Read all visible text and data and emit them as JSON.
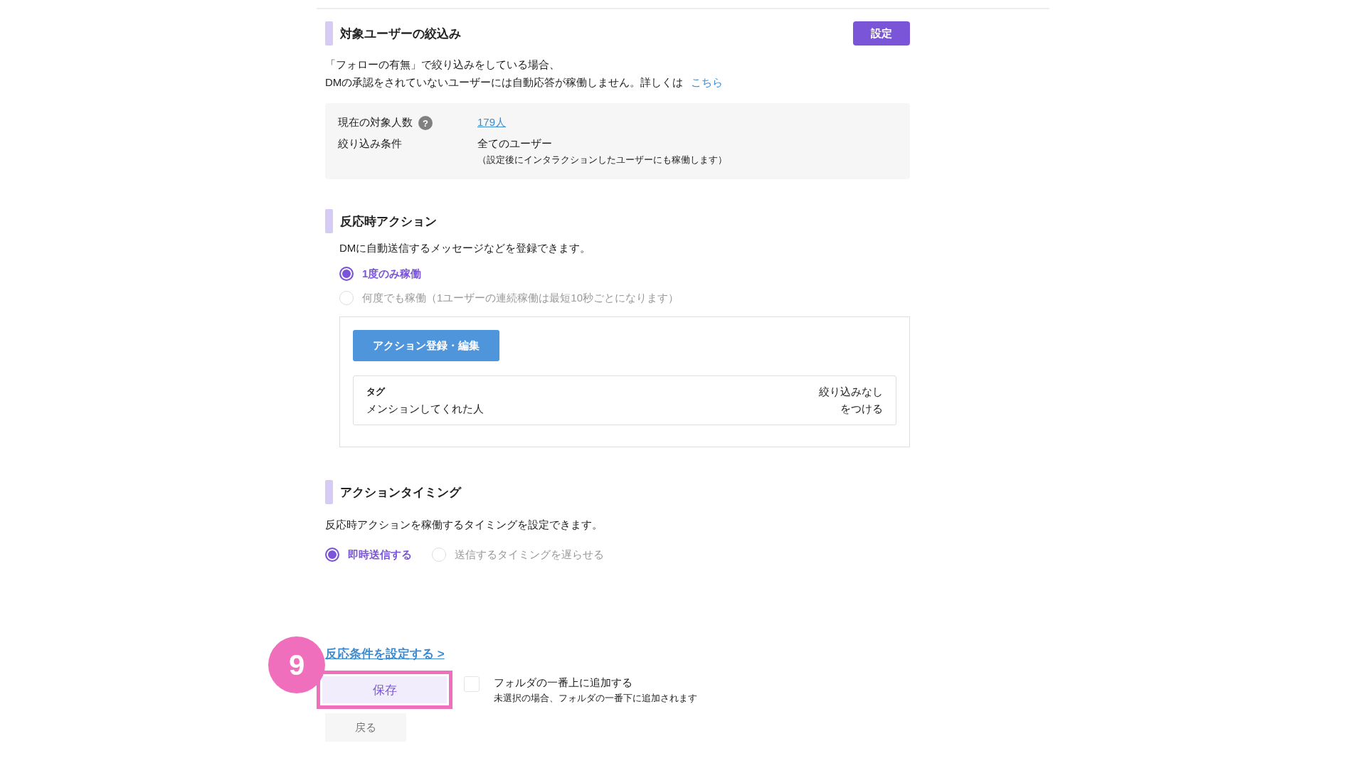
{
  "filter_section": {
    "title": "対象ユーザーの絞込み",
    "button": "設定",
    "note_lines": [
      "「フォローの有無」で絞り込みをしている場合、",
      "DMの承認をされていないユーザーには自動応答が稼働しません。詳しくは"
    ],
    "note_link": "こちら",
    "info_rows": [
      {
        "label": "現在の対象人数",
        "help_icon": "?",
        "kind": "link",
        "value": "179人"
      },
      {
        "label": "絞り込み条件",
        "kind": "text",
        "value": "全てのユーザー",
        "sub": "（設定後にインタラクションしたユーザーにも稼働します）"
      }
    ]
  },
  "action_section": {
    "title": "反応時アクション",
    "description": "DMに自動送信するメッセージなどを登録できます。",
    "options": [
      {
        "label": "1度のみ稼働",
        "selected": true
      },
      {
        "label": "何度でも稼働（1ユーザーの連続稼働は最短10秒ごとになります）",
        "selected": false
      }
    ],
    "register_button": "アクション登録・編集",
    "tag_card": {
      "label": "タグ",
      "value": "メンションしてくれた人",
      "right_lines": [
        "絞り込みなし",
        "をつける"
      ]
    }
  },
  "timing_section": {
    "title": "アクションタイミング",
    "description": "反応時アクションを稼働するタイミングを設定できます。",
    "options": [
      {
        "label": "即時送信する",
        "selected": true
      },
      {
        "label": "送信するタイミングを遅らせる",
        "selected": false
      }
    ]
  },
  "footer": {
    "link": "反応条件を設定する >",
    "save_button": "保存",
    "step_badge": "9",
    "checkbox": {
      "label": "フォルダの一番上に追加する",
      "hint": "未選択の場合、フォルダの一番下に追加されます",
      "checked": false
    },
    "back_button": "戻る"
  }
}
